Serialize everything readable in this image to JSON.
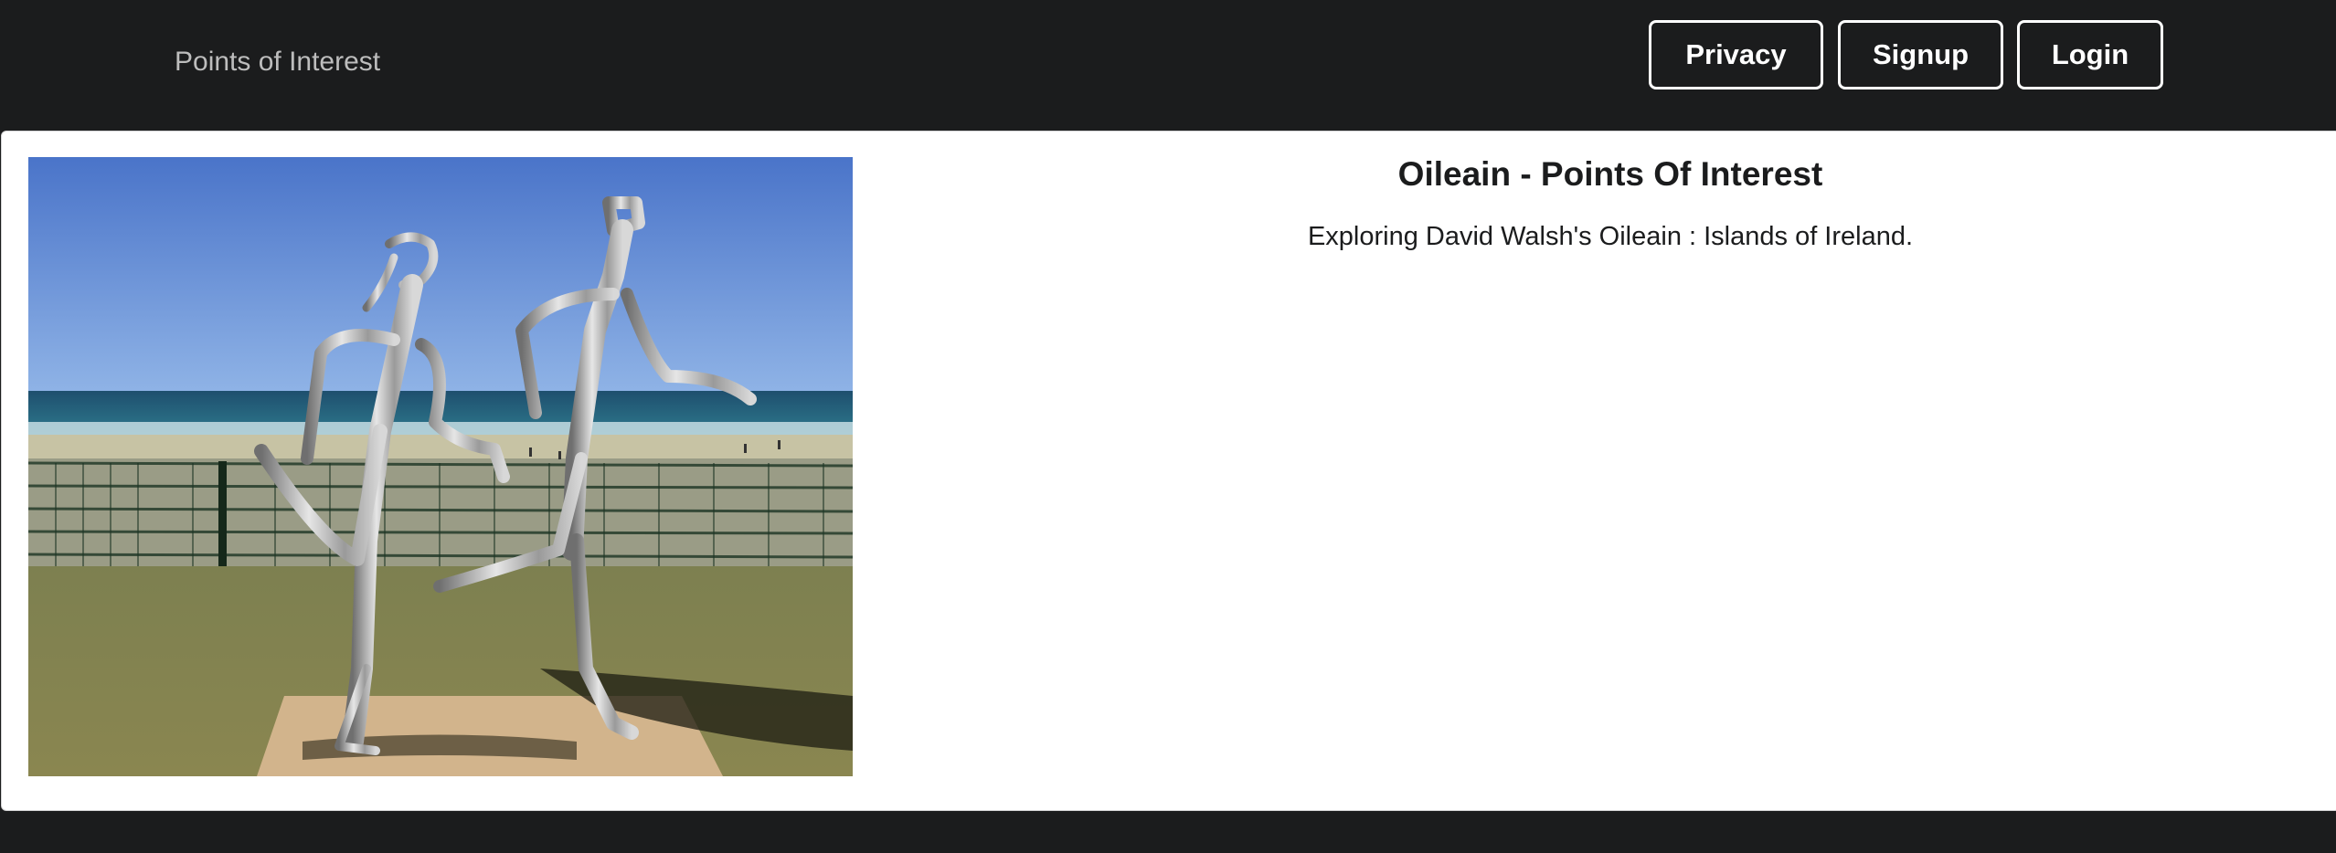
{
  "nav": {
    "brand": "Points of Interest",
    "buttons": {
      "privacy": "Privacy",
      "signup": "Signup",
      "login": "Login"
    }
  },
  "hero": {
    "title": "Oileain - Points Of Interest",
    "subtitle": "Exploring David Walsh's Oileain : Islands of Ireland."
  },
  "colors": {
    "navbar_bg": "#1b1c1d",
    "card_bg": "#ffffff",
    "button_border": "#ffffff"
  }
}
